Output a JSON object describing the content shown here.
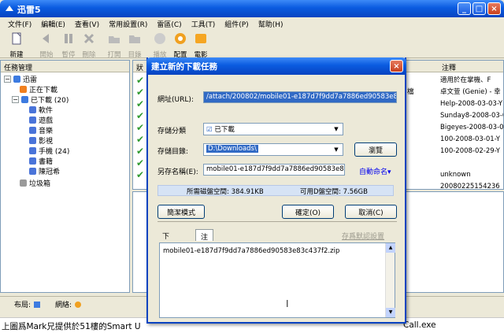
{
  "app": {
    "title": "迅雷5",
    "menu": [
      "文件(F)",
      "編輯(E)",
      "查看(V)",
      "常用設置(R)",
      "雷區(C)",
      "工具(T)",
      "組件(P)",
      "幫助(H)"
    ],
    "toolbar": {
      "new": "新建",
      "start": "開始",
      "pause": "暫停",
      "delete": "刪除",
      "open": "打開",
      "directory": "目錄",
      "play": "播放",
      "config": "配置",
      "movie": "電影"
    },
    "tree": {
      "header": "任務管理",
      "root": "迅雷",
      "downloading": "正在下載",
      "downloaded": "已下載 (20)",
      "software": "軟件",
      "games": "遊戲",
      "music": "音樂",
      "video": "影視",
      "mobile": "手機 (24)",
      "books": "書籍",
      "champion": "陳冠希",
      "trash": "垃圾箱"
    },
    "grid": {
      "col_status": "狀",
      "col_note": "注釋",
      "mid_values": [
        "",
        "檔",
        "",
        "",
        "",
        "",
        "",
        ""
      ],
      "notes": [
        "適用於在掌機、F",
        "卓文萱 (Genie) - 幸",
        "Help-2008-03-03-Y",
        "Sunday8-2008-03-0",
        "Bigeyes-2008-03-0",
        "100-2008-03-01-Y",
        "100-2008-02-29-Y",
        "",
        "unknown",
        "20080225154236"
      ]
    },
    "status": {
      "layout": "布局:",
      "network": "網絡:"
    }
  },
  "dialog": {
    "title": "建立新的下載任務",
    "url_label": "網址(URL):",
    "url_value": "/attach/200802/mobile01-e187d7f9dd7a7886ed90583e83c437f2.zip",
    "category_label": "存儲分類",
    "category_value": "已下載",
    "dir_label": "存儲目錄:",
    "dir_value": "D:\\Downloads\\",
    "browse": "瀏覽",
    "saveas_label": "另存名稱(E):",
    "saveas_value": "mobile01-e187d7f9dd7a7886ed90583e83c437f2.z",
    "auto_name": "自動命名",
    "disk_required": "所需磁盤空間: 384.91KB",
    "disk_free": "可用D盤空間: 7.56GB",
    "simple_mode": "簡潔模式",
    "ok": "確定(O)",
    "cancel": "取消(C)",
    "tab_download_settings": "下載設置",
    "tab_comment": "注釋",
    "save_default": "存爲默認設置",
    "comment_text": "mobile01-e187d7f9dd7a7886ed90583e83c437f2.zip"
  },
  "below": {
    "text": "上圖爲Mark兄提供於51樓的Smart U",
    "text_right": "Call.exe"
  }
}
